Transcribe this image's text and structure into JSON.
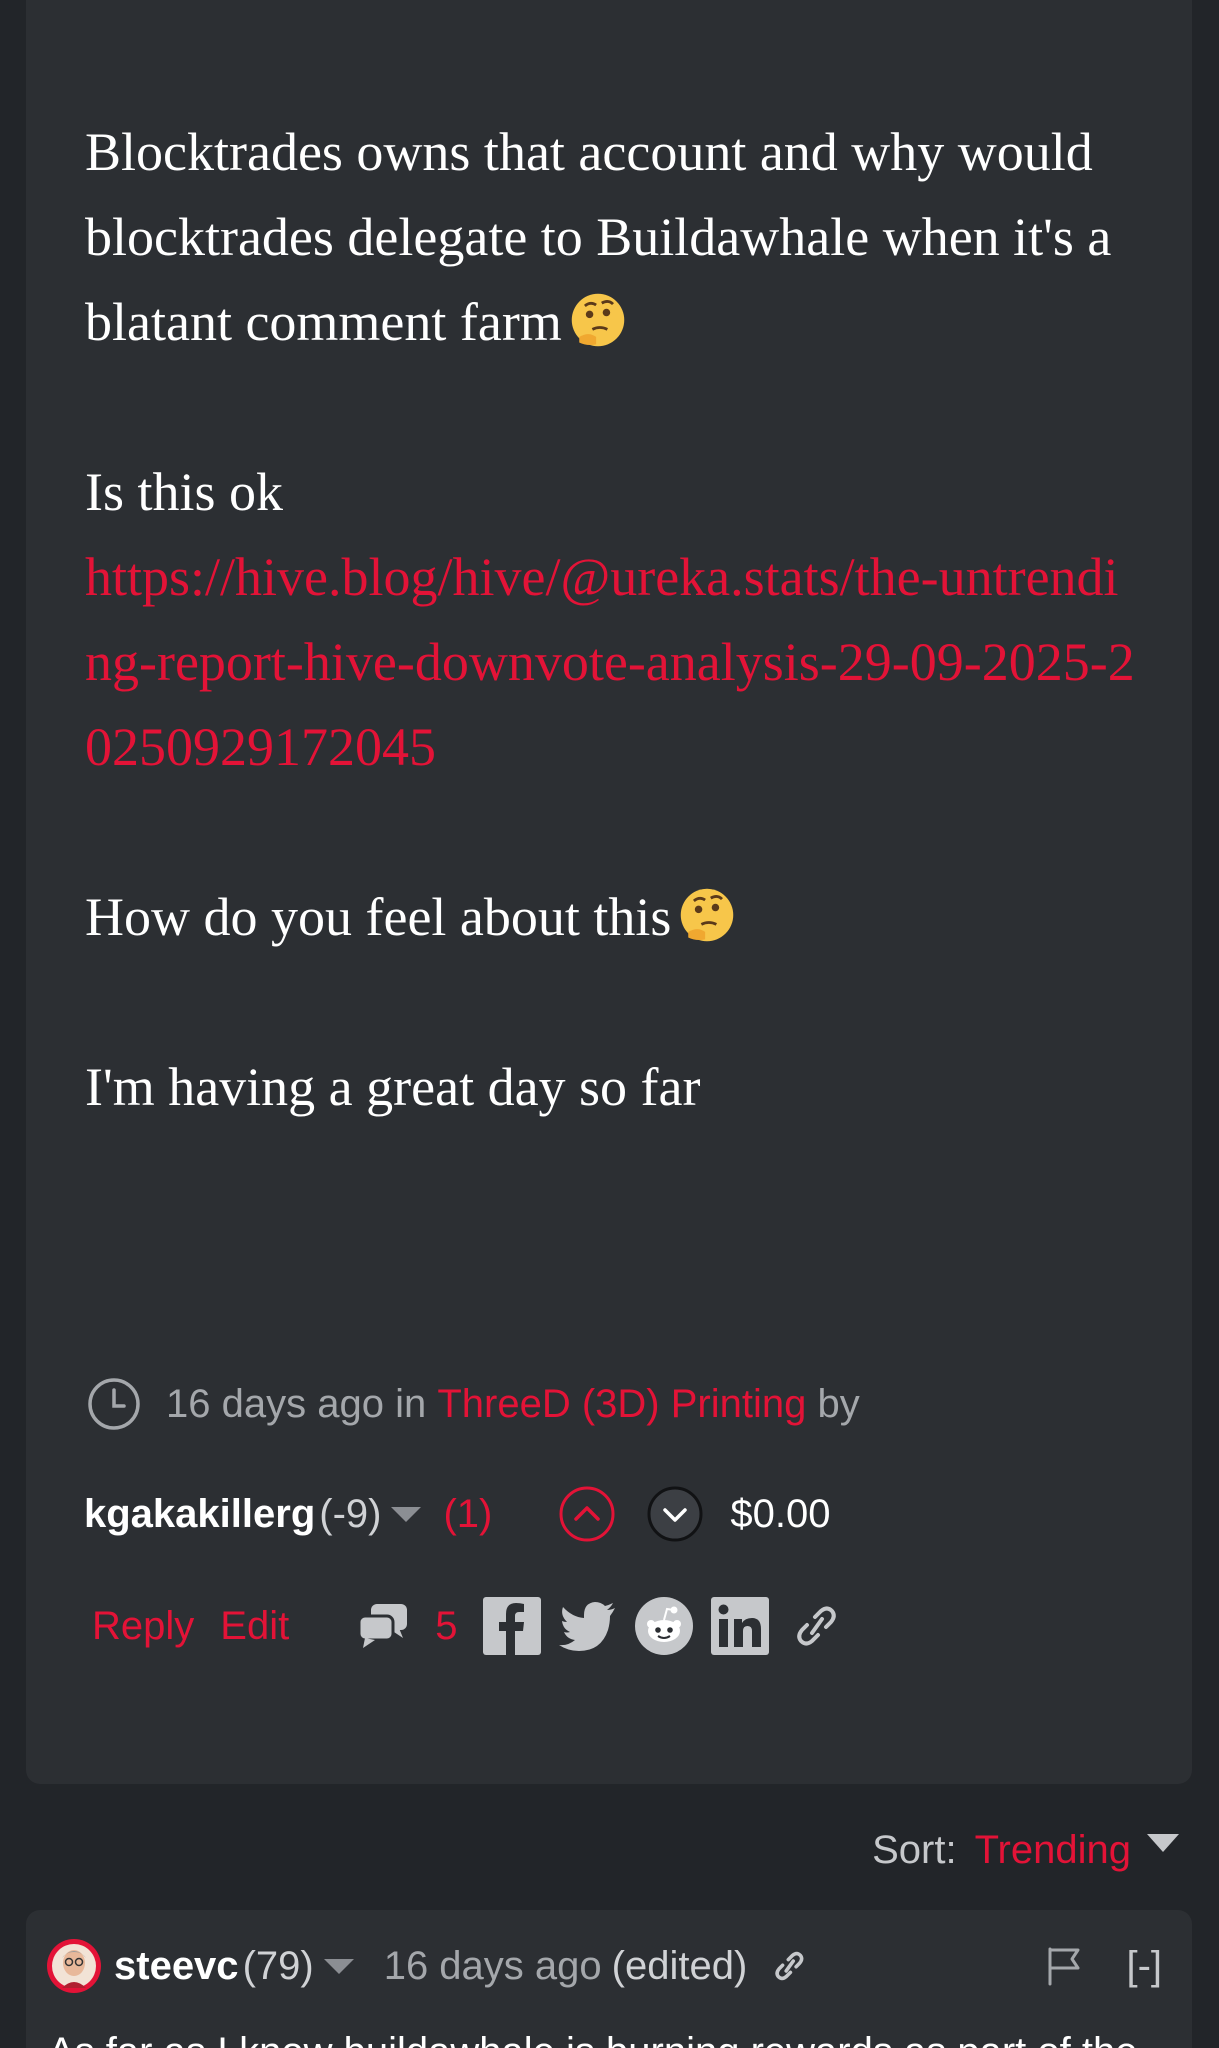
{
  "post": {
    "paragraphs": {
      "p1": "Blocktrades owns that account and why would blocktrades delegate to Buildawhale when it's a blatant comment farm",
      "p2": "Is this ok",
      "link": "https://hive.blog/hive/@ureka.stats/the-untrending-report-hive-downvote-analysis-29-09-2025-20250929172045",
      "p3": "How do you feel about this",
      "p4": "I'm having a great day so far"
    },
    "meta": {
      "time_ago": "16 days ago",
      "in_word": "in",
      "community": "ThreeD (3D) Printing",
      "by_word": "by"
    },
    "author": {
      "name": "kgakakillerg",
      "reputation": "(-9)",
      "flag_count": "(1)",
      "payout": "$0.00"
    },
    "actions": {
      "reply": "Reply",
      "edit": "Edit",
      "comments_count": "5"
    }
  },
  "sort": {
    "label": "Sort:",
    "value": "Trending"
  },
  "comment": {
    "author": "steevc",
    "reputation": "(79)",
    "time_ago": "16 days ago",
    "edited": "(edited)",
    "collapse": "[-]",
    "text": "As far as I know buildawhale is burning rewards as part of the"
  },
  "icons": {
    "clock": "clock-icon",
    "upvote": "upvote-icon",
    "downvote": "downvote-icon",
    "comments": "comments-icon",
    "facebook": "facebook-icon",
    "twitter": "twitter-icon",
    "reddit": "reddit-icon",
    "linkedin": "linkedin-icon",
    "link": "link-icon",
    "flag": "flag-icon",
    "thinking_emoji": "thinking-face-emoji"
  },
  "colors": {
    "accent": "#e31337",
    "card_bg": "#2c2f33",
    "page_bg": "#222529",
    "muted_text": "#a4a7ab"
  }
}
